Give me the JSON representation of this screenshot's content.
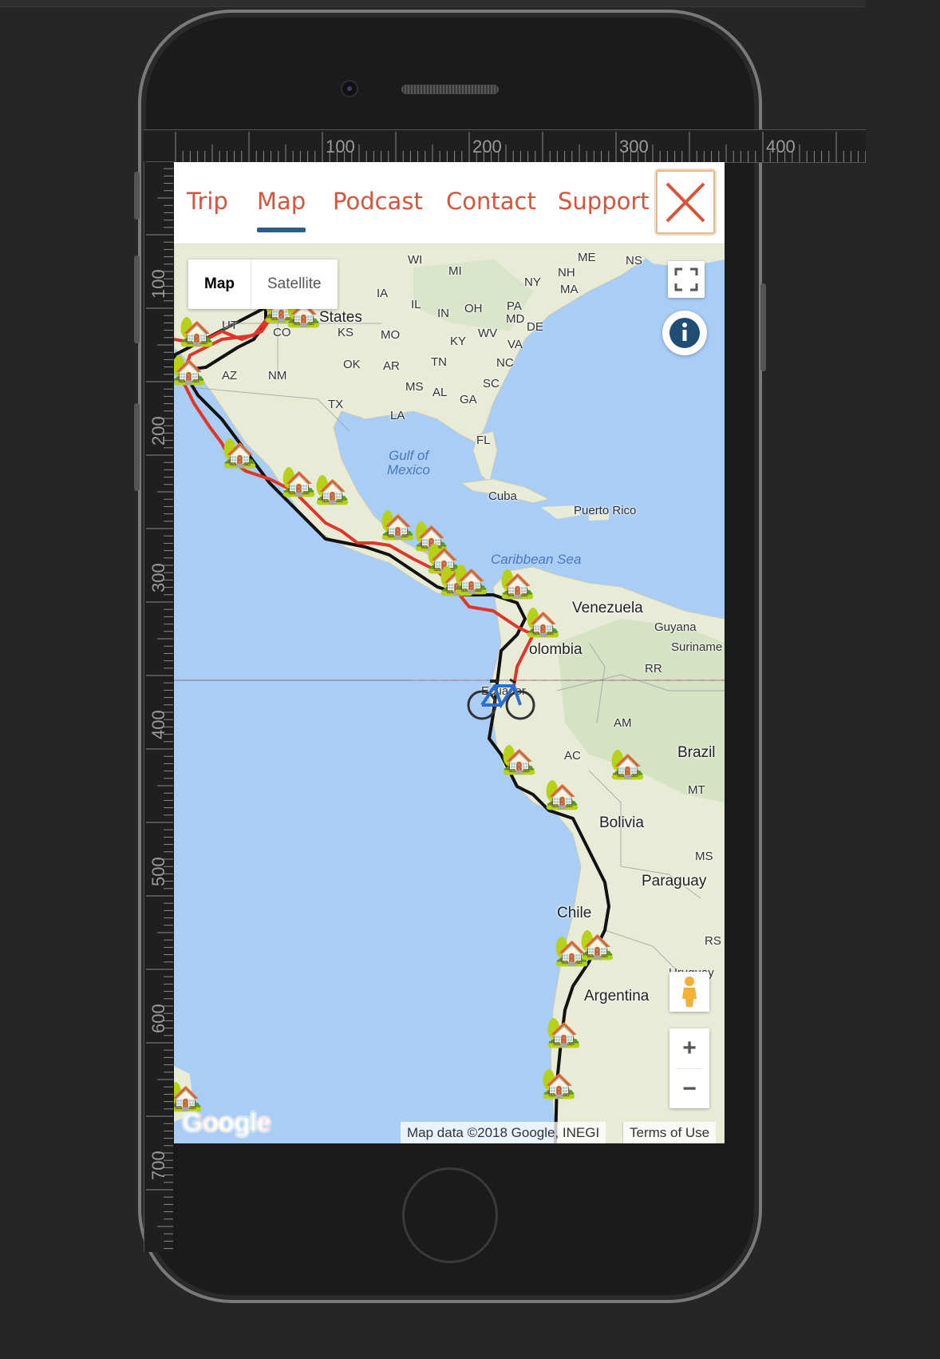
{
  "nav": {
    "items": [
      "Trip",
      "Map",
      "Podcast",
      "Contact",
      "Support"
    ],
    "active": "Map",
    "close_icon": "close-x-icon"
  },
  "ruler": {
    "h_ticks": [
      "100",
      "200",
      "300",
      "400"
    ],
    "v_ticks": [
      "100",
      "200",
      "300",
      "400",
      "500",
      "600",
      "700"
    ]
  },
  "map": {
    "type_buttons": {
      "map": "Map",
      "satellite": "Satellite"
    },
    "zoom_in": "+",
    "zoom_out": "−",
    "logo": "Google",
    "attribution": "Map data ©2018 Google, INEGI",
    "terms": "Terms of Use",
    "labels": {
      "united_states": "States",
      "gulf": "Gulf of",
      "mexico_sea": "Mexico",
      "cuba": "Cuba",
      "puerto_rico": "Puerto Rico",
      "caribbean": "Caribbean Sea",
      "venezuela": "Venezuela",
      "guyana": "Guyana",
      "suriname": "Suriname",
      "colombia": "olombia",
      "ecuador": "Ecuador",
      "brazil": "Brazil",
      "bolivia": "Bolivia",
      "paraguay": "Paraguay",
      "chile": "Chile",
      "argentina": "Argentina",
      "uruguay": "Uruguay",
      "wi": "WI",
      "mi": "MI",
      "me": "ME",
      "ns": "NS",
      "nh": "NH",
      "ny": "NY",
      "ma": "MA",
      "ia": "IA",
      "il": "IL",
      "in": "IN",
      "oh": "OH",
      "pa": "PA",
      "md": "MD",
      "de": "DE",
      "ut": "UT",
      "co": "CO",
      "ks": "KS",
      "mo": "MO",
      "wv": "WV",
      "va": "VA",
      "ky": "KY",
      "az": "AZ",
      "nm": "NM",
      "ok": "OK",
      "ar": "AR",
      "tn": "TN",
      "nc": "NC",
      "ms": "MS",
      "al": "AL",
      "ga": "GA",
      "sc": "SC",
      "tx": "TX",
      "la": "LA",
      "fl": "FL",
      "rr": "RR",
      "am": "AM",
      "ac": "AC",
      "mt": "MT",
      "ms_br": "MS",
      "rs": "RS"
    },
    "icons": [
      "fullscreen-icon",
      "info-icon",
      "pegman-icon",
      "house-marker-icon",
      "bicycle-icon"
    ]
  },
  "colors": {
    "nav_text": "#d9533b",
    "nav_underline": "#2b5f8a",
    "water": "#a9cdf5",
    "land": "#e8ecd7",
    "route_red": "#e0352b",
    "route_black": "#111111"
  }
}
